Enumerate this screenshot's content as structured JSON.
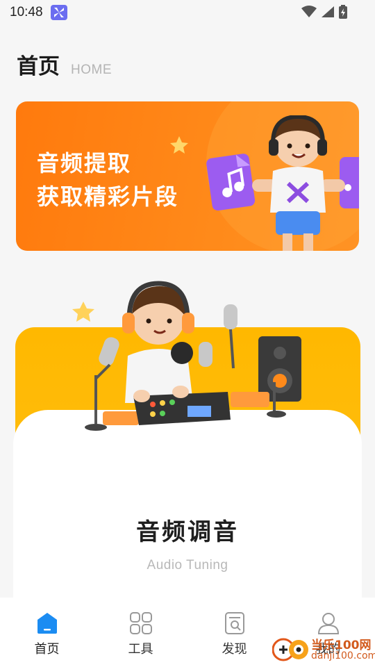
{
  "status_bar": {
    "time": "10:48"
  },
  "header": {
    "title": "首页",
    "subtitle": "HOME"
  },
  "banner": {
    "line1": "音频提取",
    "line2": "获取精彩片段"
  },
  "tuning_card": {
    "title": "音频调音",
    "subtitle": "Audio Tuning"
  },
  "bottom_nav": {
    "items": [
      {
        "label": "首页",
        "icon": "home-icon",
        "active": true
      },
      {
        "label": "工具",
        "icon": "tools-grid-icon",
        "active": false
      },
      {
        "label": "发现",
        "icon": "discover-icon",
        "active": false
      },
      {
        "label": "我的",
        "icon": "profile-icon",
        "active": false
      }
    ]
  },
  "watermark": {
    "line1": "当乐100网",
    "line2": "danji100.com"
  },
  "colors": {
    "accent": "#1b8cf2",
    "banner": "#ff7a0d",
    "card": "#ffb800"
  }
}
